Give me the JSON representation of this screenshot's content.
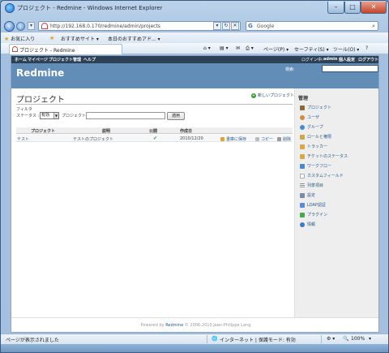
{
  "window": {
    "title": "プロジェクト - Redmine - Windows Internet Explorer",
    "min_glyph": "–",
    "max_glyph": "□",
    "close_glyph": "✕"
  },
  "address_bar": {
    "url": "http://192.168.0.170/redmine/admin/projects"
  },
  "search_bar": {
    "placeholder": "Google"
  },
  "favorites_bar": {
    "favorites_label": "お気に入り",
    "items": [
      "おすすめサイト ▾",
      "本日のおすすめアド... ▾"
    ]
  },
  "tab": {
    "title": "プロジェクト - Redmine"
  },
  "command_bar": {
    "page": "ページ(P) ▾",
    "safety": "セーフティ(S) ▾",
    "tools": "ツール(O) ▾",
    "help": "?"
  },
  "redmine": {
    "top_menu": [
      "ホーム",
      "マイページ",
      "プロジェクト",
      "管理",
      "ヘルプ"
    ],
    "account_menu": [
      "ログイン中:",
      "admin",
      "個人設定",
      "ログアウト"
    ],
    "brand": "Redmine",
    "search_label": "検索:",
    "page_title": "プロジェクト",
    "new_project_label": "新しいプロジェクト",
    "filter": {
      "legend": "フィルタ",
      "status_label": "ステータス :",
      "status_value": "有効",
      "project_label": "プロジェクト :",
      "project_value": "",
      "apply_label": "適用"
    },
    "table": {
      "headers": [
        "プロジェクト",
        "説明",
        "公開",
        "作成日"
      ],
      "rows": [
        {
          "name": "テスト",
          "description": "テストのプロジェクト",
          "public": "✔",
          "created": "2010/12/20",
          "archive": "書庫に保存",
          "copy": "コピー",
          "delete": "削除"
        }
      ]
    },
    "sidebar": {
      "heading": "管理",
      "items": [
        "プロジェクト",
        "ユーザ",
        "グループ",
        "ロールと権限",
        "トラッカー",
        "チケットのステータス",
        "ワークフロー",
        "カスタムフィールド",
        "列挙項目",
        "設定",
        "LDAP認証",
        "プラグイン",
        "情報"
      ]
    },
    "footer": {
      "powered_by": "Powered by",
      "redmine_link": "Redmine",
      "copyright": "© 2006-2010 Jean-Philippe Lang"
    }
  },
  "status_bar": {
    "message": "ページが表示されました",
    "zone": "インターネット | 保護モード: 有効",
    "zoom": "100%"
  },
  "colors": {
    "header_bg": "#628db6",
    "top_menu_bg": "#2c4156",
    "link": "#2a5a8a"
  }
}
